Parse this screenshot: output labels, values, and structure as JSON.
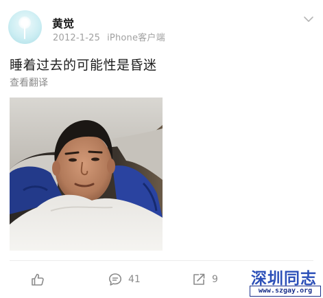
{
  "post": {
    "author": "黄觉",
    "date": "2012-1-25",
    "source": "iPhone客户端",
    "text": "睡着过去的可能性是昏迷",
    "translate_label": "查看翻译"
  },
  "actions": {
    "comments": "41",
    "reposts": "9"
  },
  "watermark": {
    "title": "深圳同志",
    "url": "www.szgay.org"
  },
  "icons": {
    "like": "thumbs-up-icon",
    "comment": "comment-bubble-icon",
    "repost": "share-arrow-icon",
    "menu": "chevron-down-icon"
  }
}
